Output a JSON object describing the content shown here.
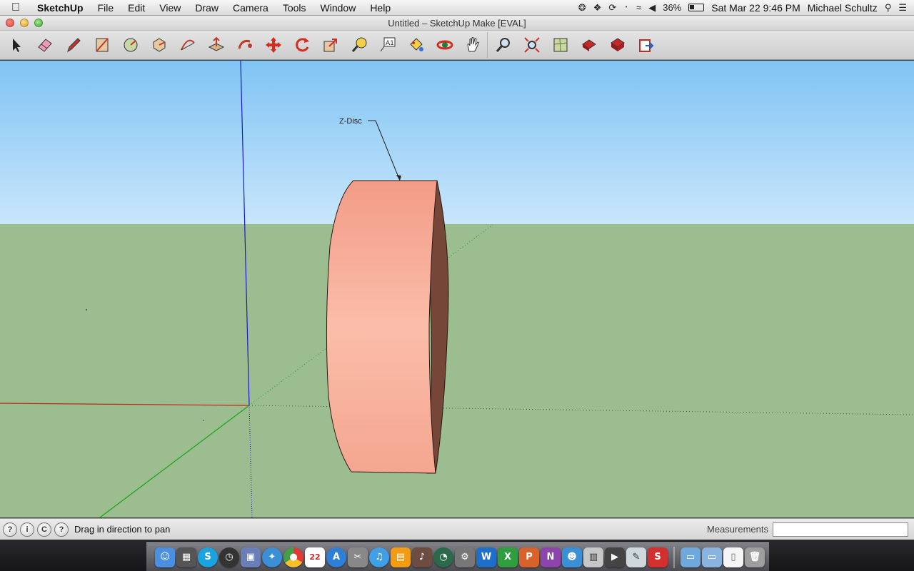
{
  "menubar": {
    "app_name": "SketchUp",
    "menus": [
      "File",
      "Edit",
      "View",
      "Draw",
      "Camera",
      "Tools",
      "Window",
      "Help"
    ],
    "battery": "36%",
    "datetime": "Sat Mar 22  9:46 PM",
    "user": "Michael Schultz"
  },
  "window": {
    "title": "Untitled – SketchUp Make [EVAL]"
  },
  "toolbar": {
    "tools": [
      "select",
      "eraser",
      "pencil",
      "rectangle",
      "circle",
      "polygon",
      "arc",
      "push-pull",
      "follow-me",
      "move",
      "rotate",
      "scale",
      "tape-measure",
      "text",
      "paint-bucket",
      "orbit",
      "pan",
      "zoom",
      "zoom-extents",
      "get-models",
      "share-model",
      "share-component",
      "send-to-layout"
    ]
  },
  "viewport": {
    "label": "Z-Disc",
    "colors": {
      "sky_top": "#80c4f4",
      "sky_bottom": "#c9e6fb",
      "ground": "#9bbd8f",
      "disc_face": "#f7b19f",
      "disc_side": "#764739",
      "axis_red": "#c2261d",
      "axis_green": "#1aa51a",
      "axis_blue": "#1a1acc"
    }
  },
  "statusbar": {
    "message": "Drag in direction to pan",
    "measurements_label": "Measurements",
    "measurements_value": ""
  },
  "dock": {
    "calendar_day": "22"
  }
}
